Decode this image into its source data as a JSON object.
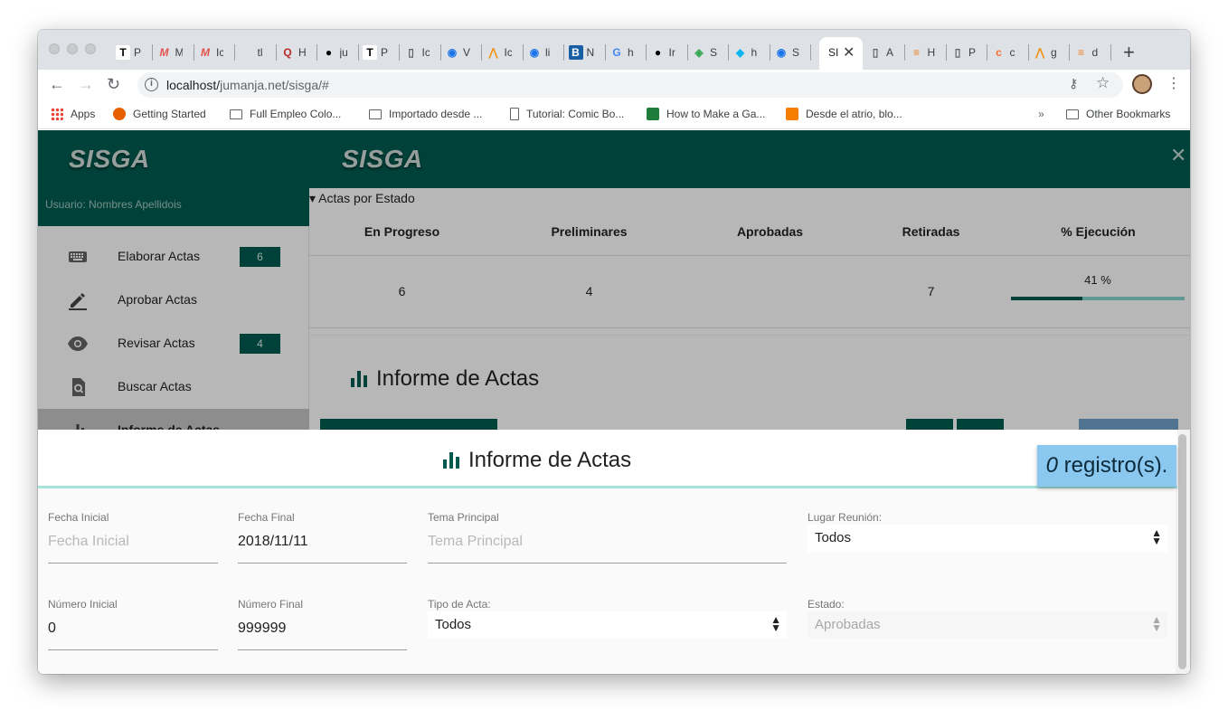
{
  "browser": {
    "tabs": [
      {
        "title": "P",
        "icon": "T"
      },
      {
        "title": "M",
        "icon": "Ms"
      },
      {
        "title": "Ic",
        "icon": "Ms"
      },
      {
        "title": "tl",
        "icon": ""
      },
      {
        "title": "H",
        "icon": "Q"
      },
      {
        "title": "ju",
        "icon": "GH"
      },
      {
        "title": "P",
        "icon": "T"
      },
      {
        "title": "Ic",
        "icon": "doc"
      },
      {
        "title": "V",
        "icon": "globe"
      },
      {
        "title": "Ic",
        "icon": "pma"
      },
      {
        "title": "li",
        "icon": "globe"
      },
      {
        "title": "N",
        "icon": "B"
      },
      {
        "title": "h",
        "icon": "G"
      },
      {
        "title": "Ir",
        "icon": "GH"
      },
      {
        "title": "S",
        "icon": "S"
      },
      {
        "title": "h",
        "icon": "docker"
      },
      {
        "title": "S",
        "icon": "globe"
      }
    ],
    "active_tab": {
      "title": "SI"
    },
    "tabs_after": [
      {
        "title": "A",
        "icon": "doc"
      },
      {
        "title": "H",
        "icon": "so"
      },
      {
        "title": "P",
        "icon": "doc"
      },
      {
        "title": "c",
        "icon": "cp"
      },
      {
        "title": "g",
        "icon": "pma"
      },
      {
        "title": "d",
        "icon": "so"
      }
    ],
    "url_host": "localhost/",
    "url_path": "jumanja.net/sisga/#",
    "bookmarks": [
      {
        "label": "Apps",
        "icon": "apps-grid-icon"
      },
      {
        "label": "Getting Started",
        "icon": "firefox-icon"
      },
      {
        "label": "Full Empleo Colo...",
        "icon": "folder-icon"
      },
      {
        "label": "Importado desde ...",
        "icon": "folder-icon"
      },
      {
        "label": "Tutorial: Comic Bo...",
        "icon": "page-icon"
      },
      {
        "label": "How to Make a Ga...",
        "icon": "m-logo-icon"
      },
      {
        "label": "Desde el atrio, blo...",
        "icon": "blogger-icon"
      }
    ],
    "bookmarks_overflow": "»",
    "other_bookmarks": "Other Bookmarks"
  },
  "app": {
    "brand": "SISGA",
    "user": "Usuario: Nombres Apellidois",
    "menu": [
      {
        "label": "Elaborar Actas",
        "badge": "6",
        "icon": "keyboard-icon"
      },
      {
        "label": "Aprobar Actas",
        "badge": "",
        "icon": "pencil-icon"
      },
      {
        "label": "Revisar Actas",
        "badge": "4",
        "icon": "eye-icon"
      },
      {
        "label": "Buscar Actas",
        "badge": "",
        "icon": "search-document-icon"
      },
      {
        "label": "Informe de Actas",
        "badge": "",
        "icon": "bar-chart-icon"
      }
    ],
    "summary": {
      "title": "▾ Actas por Estado",
      "headers": [
        "En Progreso",
        "Preliminares",
        "Aprobadas",
        "Retiradas",
        "% Ejecución"
      ],
      "values": [
        "6",
        "4",
        "",
        "7"
      ],
      "progress_label": "41 %",
      "progress": 0.41
    },
    "report_title": "Informe de Actas"
  },
  "sheet": {
    "title": "Informe de Actas",
    "count_number": "0",
    "count_suffix": " registro(s).",
    "fields": {
      "fecha_inicial": {
        "label": "Fecha Inicial",
        "placeholder": "Fecha Inicial",
        "value": ""
      },
      "fecha_final": {
        "label": "Fecha Final",
        "value": "2018/11/11"
      },
      "tema_principal": {
        "label": "Tema Principal",
        "placeholder": "Tema Principal",
        "value": ""
      },
      "lugar_reunion": {
        "label": "Lugar Reunión:",
        "value": "Todos"
      },
      "numero_inicial": {
        "label": "Número Inicial",
        "value": "0"
      },
      "numero_final": {
        "label": "Número Final",
        "value": "999999"
      },
      "tipo_acta": {
        "label": "Tipo de Acta:",
        "value": "Todos"
      },
      "estado": {
        "label": "Estado:",
        "value": "Aprobadas"
      }
    }
  },
  "colors": {
    "primary": "#00594e",
    "accent_line": "#a7e3dd",
    "badge_blue": "#8ac8f0"
  }
}
